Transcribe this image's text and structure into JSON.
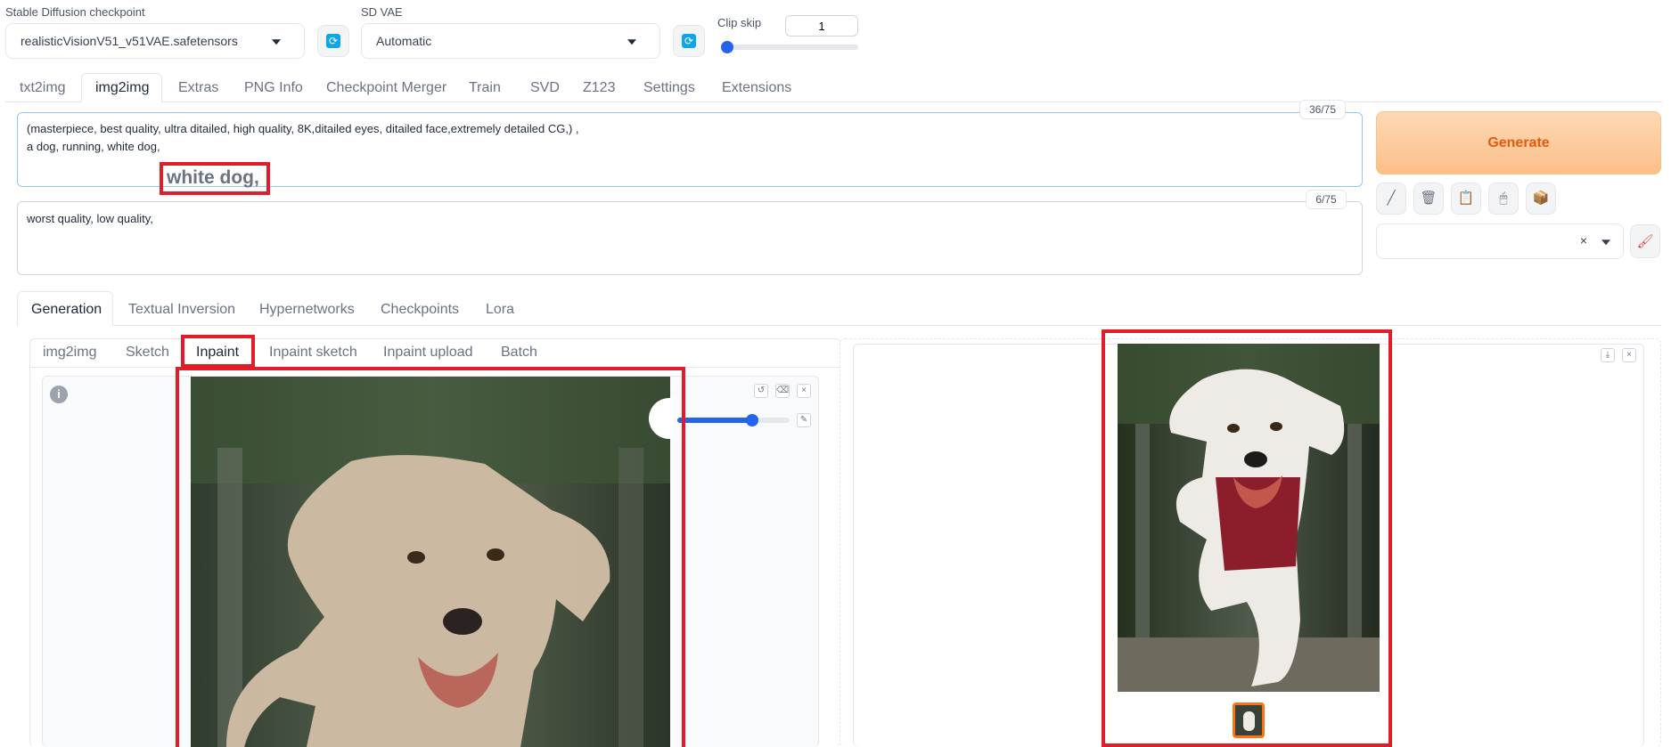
{
  "settings": {
    "checkpoint": {
      "label": "Stable Diffusion checkpoint",
      "value": "realisticVisionV51_v51VAE.safetensors"
    },
    "vae": {
      "label": "SD VAE",
      "value": "Automatic"
    },
    "clip_skip": {
      "label": "Clip skip",
      "value": "1",
      "slider_fraction": 0.0
    }
  },
  "main_tabs": [
    "txt2img",
    "img2img",
    "Extras",
    "PNG Info",
    "Checkpoint Merger",
    "Train",
    "SVD",
    "Z123",
    "Settings",
    "Extensions"
  ],
  "main_tab_active": "img2img",
  "prompt": {
    "line1": "(masterpiece, best quality, ultra ditailed, high quality, 8K,ditailed eyes, ditailed face,extremely detailed CG,) ,",
    "line2": "a dog, running,  white dog,",
    "counter": "36/75",
    "callout": "white dog,"
  },
  "negative_prompt": {
    "text": "worst quality, low quality,",
    "counter": "6/75"
  },
  "generate_label": "Generate",
  "tool_icons": [
    "pencil-icon",
    "trash-icon",
    "clipboard-icon",
    "mouse-icon",
    "box-icon"
  ],
  "style_clear": "×",
  "extra_tabs": [
    "Generation",
    "Textual Inversion",
    "Hypernetworks",
    "Checkpoints",
    "Lora"
  ],
  "extra_tab_active": "Generation",
  "mode_tabs": [
    "img2img",
    "Sketch",
    "Inpaint",
    "Inpaint sketch",
    "Inpaint upload",
    "Batch"
  ],
  "mode_tab_active": "Inpaint",
  "brush_size_fraction": 0.67,
  "colors": {
    "accent_blue": "#2563eb",
    "highlight_red": "#e11d2a",
    "generate_orange": "#ea580c"
  }
}
